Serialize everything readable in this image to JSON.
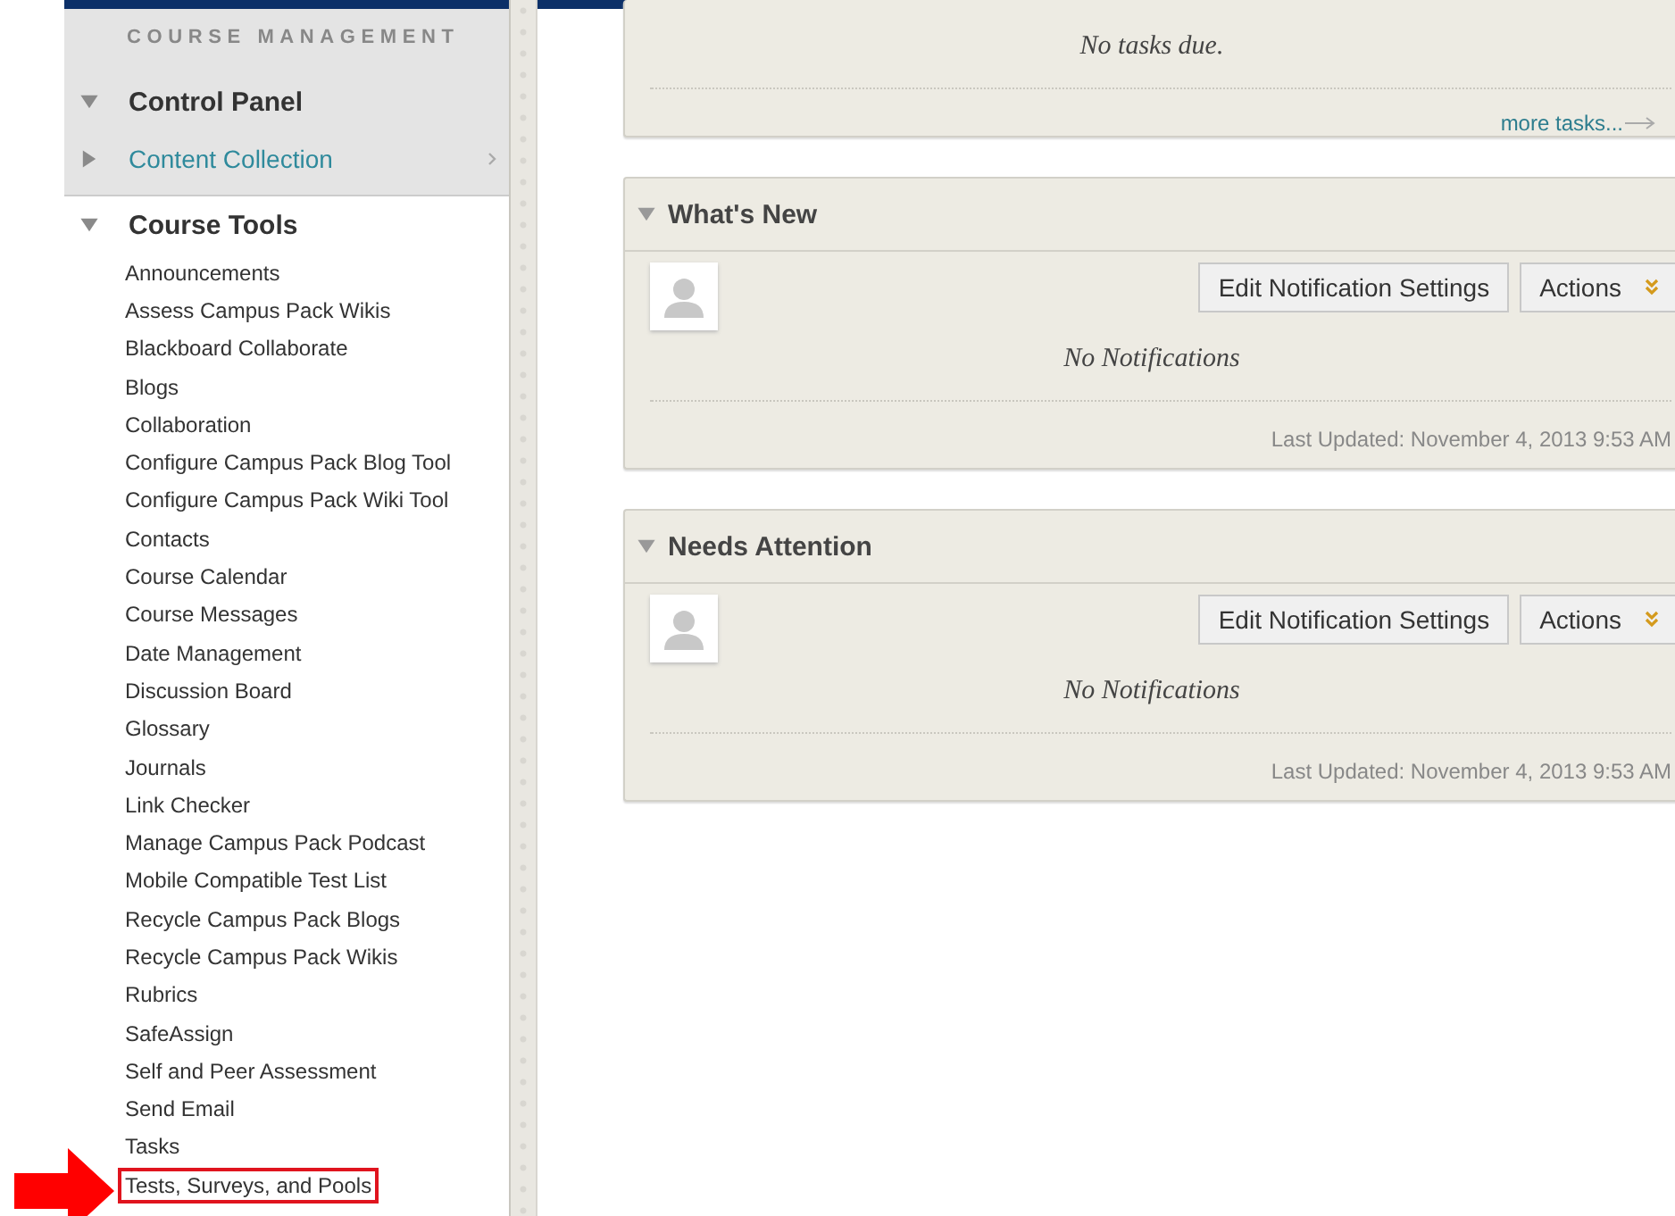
{
  "sidebar": {
    "heading": "COURSE MANAGEMENT",
    "items": [
      {
        "label": "Control Panel",
        "expanded": true,
        "children": [
          {
            "label": "Content Collection",
            "expanded": false
          }
        ]
      },
      {
        "label": "Course Tools",
        "expanded": true,
        "children": [
          {
            "label": "Announcements",
            "highlighted": false
          },
          {
            "label": "Assess Campus Pack Wikis",
            "highlighted": false
          },
          {
            "label": "Blackboard Collaborate",
            "highlighted": false
          },
          {
            "label": "Blogs",
            "highlighted": false
          },
          {
            "label": "Collaboration",
            "highlighted": false
          },
          {
            "label": "Configure Campus Pack Blog Tool",
            "highlighted": false
          },
          {
            "label": "Configure Campus Pack Wiki Tool",
            "highlighted": false
          },
          {
            "label": "Contacts",
            "highlighted": false
          },
          {
            "label": "Course Calendar",
            "highlighted": false
          },
          {
            "label": "Course Messages",
            "highlighted": false
          },
          {
            "label": "Date Management",
            "highlighted": false
          },
          {
            "label": "Discussion Board",
            "highlighted": false
          },
          {
            "label": "Glossary",
            "highlighted": false
          },
          {
            "label": "Journals",
            "highlighted": false
          },
          {
            "label": "Link Checker",
            "highlighted": false
          },
          {
            "label": "Manage Campus Pack Podcast",
            "highlighted": false
          },
          {
            "label": "Mobile Compatible Test List",
            "highlighted": false
          },
          {
            "label": "Recycle Campus Pack Blogs",
            "highlighted": false
          },
          {
            "label": "Recycle Campus Pack Wikis",
            "highlighted": false
          },
          {
            "label": "Rubrics",
            "highlighted": false
          },
          {
            "label": "SafeAssign",
            "highlighted": false
          },
          {
            "label": "Self and Peer Assessment",
            "highlighted": false
          },
          {
            "label": "Send Email",
            "highlighted": false
          },
          {
            "label": "Tasks",
            "highlighted": false
          },
          {
            "label": "Tests, Surveys, and Pools",
            "highlighted": true
          }
        ]
      }
    ]
  },
  "tasks_panel": {
    "message": "No tasks due.",
    "link": "more tasks..."
  },
  "panels": [
    {
      "title": "What's New",
      "expanded": true,
      "buttons": [
        "Edit Notification Settings",
        "Actions"
      ],
      "message": "No Notifications",
      "updated": "Last Updated: November 4, 2013 9:53 AM"
    },
    {
      "title": "Needs Attention",
      "expanded": true,
      "buttons": [
        "Edit Notification Settings",
        "Actions"
      ],
      "message": "No Notifications",
      "updated": "Last Updated: November 4, 2013 9:53 AM"
    }
  ]
}
